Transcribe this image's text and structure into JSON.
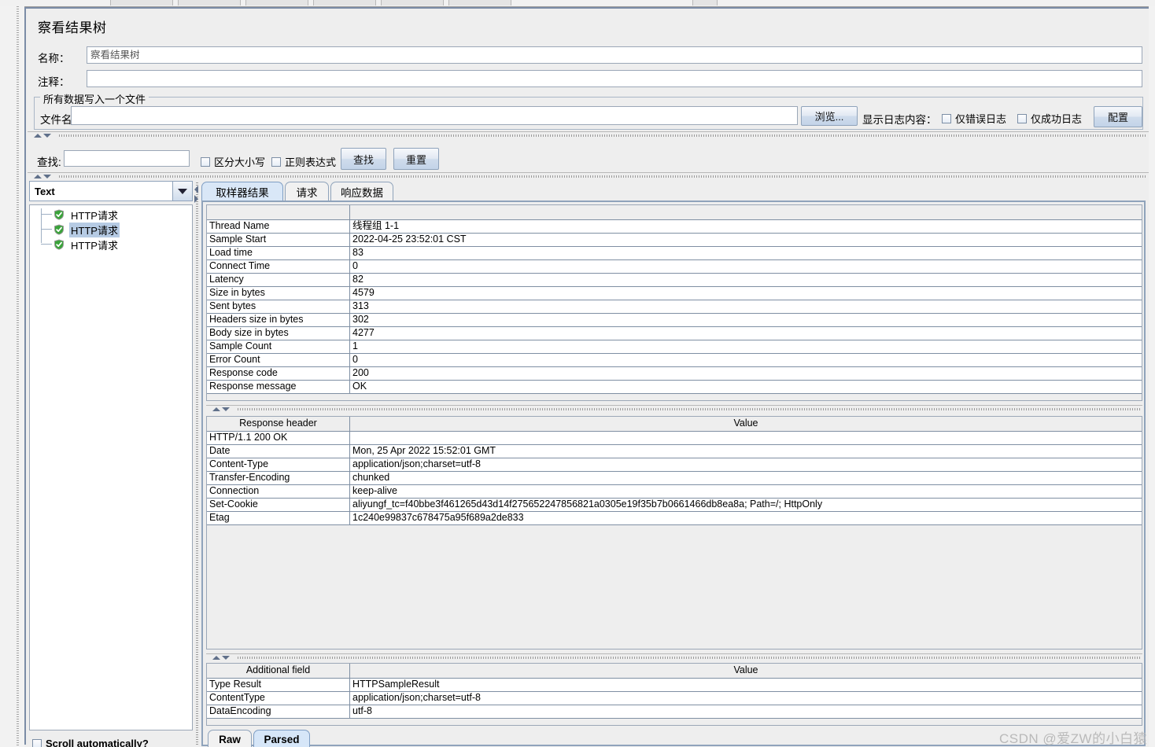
{
  "window": {
    "title": "察看结果树"
  },
  "form": {
    "name_label": "名称：",
    "name_value": "察看结果树",
    "comment_label": "注释：",
    "comment_value": "",
    "group_title": "所有数据写入一个文件",
    "filename_label": "文件名",
    "filename_value": "",
    "browse_button": "浏览...",
    "log_display_label": "显示日志内容：",
    "errors_only_label": "仅错误日志",
    "success_only_label": "仅成功日志",
    "configure_button": "配置"
  },
  "search": {
    "label": "查找:",
    "value": "",
    "case_sensitive_label": "区分大小写",
    "regex_label": "正则表达式",
    "find_button": "查找",
    "reset_button": "重置"
  },
  "tree": {
    "renderer_selected": "Text",
    "nodes": [
      {
        "label": "HTTP请求",
        "selected": false,
        "status": "ok"
      },
      {
        "label": "HTTP请求",
        "selected": true,
        "status": "ok"
      },
      {
        "label": "HTTP请求",
        "selected": false,
        "status": "ok"
      }
    ],
    "scroll_auto_label": "Scroll automatically?",
    "scroll_auto_checked": false
  },
  "tabs": {
    "items": [
      {
        "label": "取样器结果",
        "active": true
      },
      {
        "label": "请求",
        "active": false
      },
      {
        "label": "响应数据",
        "active": false
      }
    ]
  },
  "sampler_result": {
    "rows": [
      {
        "key": "Thread Name",
        "value": "线程组 1-1"
      },
      {
        "key": "Sample Start",
        "value": "2022-04-25 23:52:01 CST"
      },
      {
        "key": "Load time",
        "value": "83"
      },
      {
        "key": "Connect Time",
        "value": "0"
      },
      {
        "key": "Latency",
        "value": "82"
      },
      {
        "key": "Size in bytes",
        "value": "4579"
      },
      {
        "key": "Sent bytes",
        "value": "313"
      },
      {
        "key": "Headers size in bytes",
        "value": "302"
      },
      {
        "key": "Body size in bytes",
        "value": "4277"
      },
      {
        "key": "Sample Count",
        "value": "1"
      },
      {
        "key": "Error Count",
        "value": "0"
      },
      {
        "key": "Response code",
        "value": "200"
      },
      {
        "key": "Response message",
        "value": "OK"
      }
    ]
  },
  "response_headers": {
    "col_key": "Response header",
    "col_value": "Value",
    "rows": [
      {
        "key": "HTTP/1.1 200 OK",
        "value": ""
      },
      {
        "key": "Date",
        "value": "Mon, 25 Apr 2022 15:52:01 GMT"
      },
      {
        "key": "Content-Type",
        "value": "application/json;charset=utf-8"
      },
      {
        "key": "Transfer-Encoding",
        "value": "chunked"
      },
      {
        "key": "Connection",
        "value": "keep-alive"
      },
      {
        "key": "Set-Cookie",
        "value": "aliyungf_tc=f40bbe3f461265d43d14f275652247856821a0305e19f35b7b0661466db8ea8a; Path=/; HttpOnly"
      },
      {
        "key": "Etag",
        "value": "1c240e99837c678475a95f689a2de833"
      }
    ]
  },
  "additional_fields": {
    "col_key": "Additional field",
    "col_value": "Value",
    "rows": [
      {
        "key": "Type Result",
        "value": "HTTPSampleResult"
      },
      {
        "key": "ContentType",
        "value": "application/json;charset=utf-8"
      },
      {
        "key": "DataEncoding",
        "value": "utf-8"
      }
    ]
  },
  "view_tabs": {
    "items": [
      {
        "label": "Raw",
        "active": false
      },
      {
        "label": "Parsed",
        "active": true
      }
    ]
  },
  "watermark": {
    "text": "CSDN @爱ZW的小白猿"
  },
  "colors": {
    "accent": "#7b8ca6",
    "tab_active_bg": "#d9e7f7",
    "selection_bg": "#b6cbe4",
    "status_ok": "#2aa12a"
  }
}
